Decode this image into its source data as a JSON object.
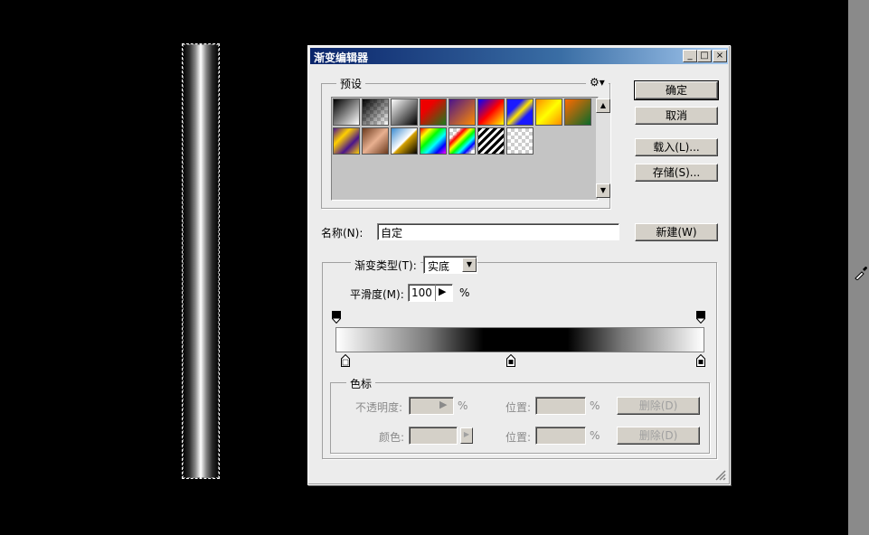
{
  "dialog": {
    "title": "渐变编辑器",
    "title_buttons": [
      "_",
      "□",
      "×"
    ]
  },
  "buttons": {
    "ok": "确定",
    "cancel": "取消",
    "load": "载入(L)...",
    "save": "存储(S)...",
    "new": "新建(W)"
  },
  "presets": {
    "label": "预设",
    "menu_icon": "gear-icon"
  },
  "name_field": {
    "label": "名称(N):",
    "value": "自定"
  },
  "gradient_type": {
    "label": "渐变类型(T):",
    "value": "实底"
  },
  "smoothness": {
    "label": "平滑度(M):",
    "value": "100",
    "unit": "%"
  },
  "stops": {
    "group_label": "色标",
    "opacity_label": "不透明度:",
    "opacity_unit": "%",
    "location1_label": "位置:",
    "location1_unit": "%",
    "delete1_label": "删除(D)",
    "color_label": "颜色:",
    "location2_label": "位置:",
    "location2_unit": "%",
    "delete2_label": "删除(D)"
  }
}
